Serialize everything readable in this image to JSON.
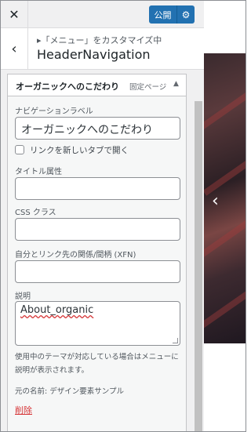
{
  "topbar": {
    "close_icon": "close-icon",
    "close_glyph": "✕",
    "publish_label": "公開",
    "settings_glyph": "⚙"
  },
  "section": {
    "back_glyph": "‹",
    "breadcrumb": "▸「メニュー」をカスタマイズ中",
    "title": "HeaderNavigation"
  },
  "menu_item": {
    "title": "オーガニックへのこだわり",
    "type": "固定ページ",
    "toggle_glyph": "▲",
    "navigation_label_label": "ナビゲーションラベル",
    "navigation_label_value": "オーガニックへのこだわり",
    "open_new_tab_label": "リンクを新しいタブで開く",
    "open_new_tab_checked": false,
    "title_attribute_label": "タイトル属性",
    "title_attribute_value": "",
    "css_classes_label": "CSS クラス",
    "css_classes_value": "",
    "xfn_label": "自分とリンク先の関係/間柄 (XFN)",
    "xfn_value": "",
    "description_label": "説明",
    "description_value": "About_organic",
    "help_text": "使用中のテーマが対応している場合はメニューに説明が表示されます。",
    "original_name_label": "元の名前:",
    "original_name_value": "デザイン要素サンプル",
    "delete_label": "削除"
  },
  "preview": {
    "arrow_glyph": "‹"
  },
  "colors": {
    "accent": "#2271b1",
    "delete": "#d63638",
    "panel_bg": "#f0f0f1"
  }
}
